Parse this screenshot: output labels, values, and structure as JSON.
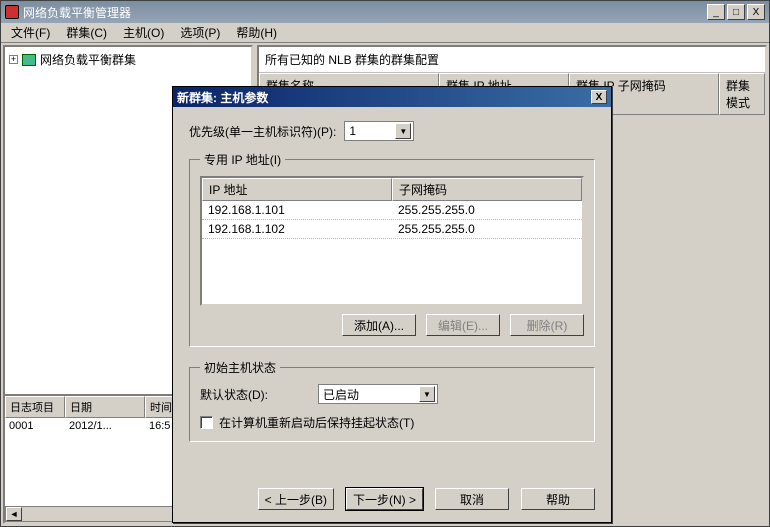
{
  "window": {
    "title": "网络负载平衡管理器",
    "controls": {
      "min": "_",
      "max": "□",
      "close": "X"
    }
  },
  "menubar": {
    "file": "文件(F)",
    "cluster": "群集(C)",
    "host": "主机(O)",
    "options": "选项(P)",
    "help": "帮助(H)"
  },
  "tree": {
    "expand": "+",
    "root": "网络负载平衡群集"
  },
  "cluster_panel": {
    "title": "所有已知的 NLB 群集的群集配置",
    "cols": {
      "name": "群集名称",
      "ip": "群集 IP 地址",
      "mask": "群集 IP 子网掩码",
      "mode": "群集模式"
    }
  },
  "log_panel": {
    "headers": {
      "item": "日志项目",
      "date": "日期",
      "time": "时间"
    },
    "rows": [
      {
        "item": "0001",
        "date": "2012/1...",
        "time": "16:5"
      }
    ]
  },
  "dialog": {
    "title": "新群集:  主机参数",
    "priority_label": "优先级(单一主机标识符)(P):",
    "priority_value": "1",
    "group_ip": {
      "legend": "专用 IP 地址(I)",
      "headers": {
        "ip": "IP 地址",
        "mask": "子网掩码"
      },
      "rows": [
        {
          "ip": "192.168.1.101",
          "mask": "255.255.255.0"
        },
        {
          "ip": "192.168.1.102",
          "mask": "255.255.255.0"
        }
      ],
      "buttons": {
        "add": "添加(A)...",
        "edit": "编辑(E)...",
        "remove": "删除(R)"
      }
    },
    "group_state": {
      "legend": "初始主机状态",
      "default_label": "默认状态(D):",
      "default_value": "已启动",
      "retain_label": "在计算机重新启动后保持挂起状态(T)"
    },
    "nav": {
      "back": "< 上一步(B)",
      "next": "下一步(N) >",
      "cancel": "取消",
      "help": "帮助"
    }
  }
}
